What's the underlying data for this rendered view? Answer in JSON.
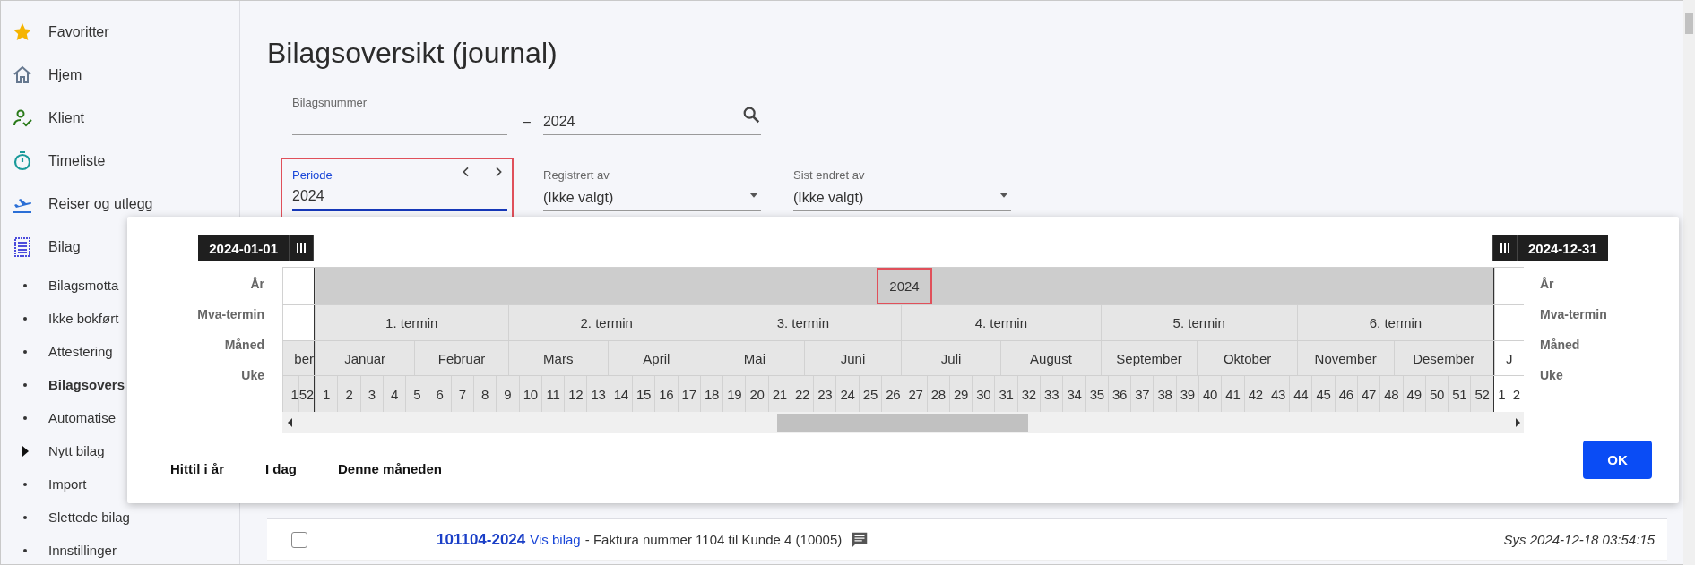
{
  "sidebar": {
    "items": [
      {
        "label": "Favoritter"
      },
      {
        "label": "Hjem"
      },
      {
        "label": "Klient"
      },
      {
        "label": "Timeliste"
      },
      {
        "label": "Reiser og utlegg"
      },
      {
        "label": "Bilag"
      }
    ],
    "subitems": [
      {
        "label": "Bilagsmotta",
        "kind": "bullet",
        "selected": false
      },
      {
        "label": "Ikke bokført",
        "kind": "bullet",
        "selected": false
      },
      {
        "label": "Attestering",
        "kind": "bullet",
        "selected": false
      },
      {
        "label": "Bilagsovers",
        "kind": "bullet",
        "selected": true
      },
      {
        "label": "Automatise",
        "kind": "bullet",
        "selected": false
      },
      {
        "label": "Nytt bilag",
        "kind": "caret",
        "selected": false
      },
      {
        "label": "Import",
        "kind": "bullet",
        "selected": false
      },
      {
        "label": "Slettede bilag",
        "kind": "bullet",
        "selected": false
      },
      {
        "label": "Innstillinger",
        "kind": "bullet",
        "selected": false
      }
    ]
  },
  "page_title": "Bilagsoversikt (journal)",
  "filters": {
    "number_from": {
      "label": "Bilagsnummer"
    },
    "separator": "–",
    "number_to": {
      "value": "2024"
    },
    "period": {
      "label": "Periode",
      "value": "2024",
      "focused": true,
      "highlighted": true
    },
    "registered_by": {
      "label": "Registrert av",
      "value": "(Ikke valgt)"
    },
    "changed_by": {
      "label": "Sist endret av",
      "value": "(Ikke valgt)"
    }
  },
  "period_picker": {
    "start_label": "2024-01-01",
    "end_label": "2024-12-31",
    "row_labels": [
      "År",
      "Mva-termin",
      "Måned",
      "Uke"
    ],
    "right_row_labels": [
      "År",
      "Mva-termin",
      "Måned",
      "Uke"
    ],
    "years": [
      {
        "label": "2024",
        "highlighted": true
      }
    ],
    "terms": [
      {
        "label": "1. termin"
      },
      {
        "label": "2. termin"
      },
      {
        "label": "3. termin"
      },
      {
        "label": "4. termin"
      },
      {
        "label": "5. termin"
      },
      {
        "label": "6. termin"
      }
    ],
    "months": [
      {
        "label": "Januar"
      },
      {
        "label": "Februar"
      },
      {
        "label": "Mars"
      },
      {
        "label": "April"
      },
      {
        "label": "Mai"
      },
      {
        "label": "Juni"
      },
      {
        "label": "Juli"
      },
      {
        "label": "August"
      },
      {
        "label": "September"
      },
      {
        "label": "Oktober"
      },
      {
        "label": "November"
      },
      {
        "label": "Desember"
      }
    ],
    "weeks": [
      "1",
      "2",
      "3",
      "4",
      "5",
      "6",
      "7",
      "8",
      "9",
      "10",
      "11",
      "12",
      "13",
      "14",
      "15",
      "16",
      "17",
      "18",
      "19",
      "20",
      "21",
      "22",
      "23",
      "24",
      "25",
      "26",
      "27",
      "28",
      "29",
      "30",
      "31",
      "32",
      "33",
      "34",
      "35",
      "36",
      "37",
      "38",
      "39",
      "40",
      "41",
      "42",
      "43",
      "44",
      "45",
      "46",
      "47",
      "48",
      "49",
      "50",
      "51",
      "52"
    ],
    "before": {
      "month": "ber",
      "weeks": [
        "1",
        "52"
      ]
    },
    "after": {
      "month": "J",
      "weeks": [
        "1",
        "2"
      ]
    },
    "shortcuts": [
      "Hittil i år",
      "I dag",
      "Denne måneden"
    ],
    "ok_label": "OK"
  },
  "table": {
    "rows": [
      {
        "checked": false,
        "number": "101104-2024",
        "link": "Vis bilag",
        "description": "- Faktura nummer 1104 til Kunde 4 (10005)",
        "has_comment": true,
        "created": "Sys 2024-12-18 03:54:15"
      }
    ]
  }
}
